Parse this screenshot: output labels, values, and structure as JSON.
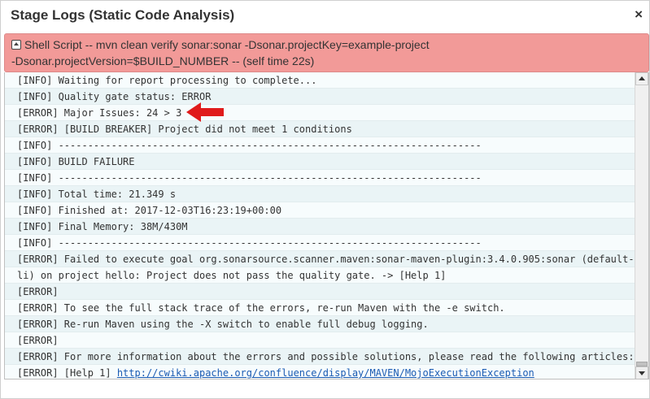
{
  "dialog": {
    "title": "Stage Logs (Static Code Analysis)",
    "close_label": "×"
  },
  "step": {
    "line1": "Shell Script -- mvn clean verify sonar:sonar -Dsonar.projectKey=example-project",
    "line2": "-Dsonar.projectVersion=$BUILD_NUMBER -- (self time 22s)"
  },
  "log": {
    "lines": [
      "[INFO] Waiting for report processing to complete...",
      "[INFO] Quality gate status: ERROR",
      "[ERROR] Major Issues: 24 > 3",
      "[ERROR] [BUILD BREAKER] Project did not meet 1 conditions",
      "[INFO] ------------------------------------------------------------------------",
      "[INFO] BUILD FAILURE",
      "[INFO] ------------------------------------------------------------------------",
      "[INFO] Total time: 21.349 s",
      "[INFO] Finished at: 2017-12-03T16:23:19+00:00",
      "[INFO] Final Memory: 38M/430M",
      "[INFO] ------------------------------------------------------------------------",
      "[ERROR] Failed to execute goal org.sonarsource.scanner.maven:sonar-maven-plugin:3.4.0.905:sonar (default-c",
      "li) on project hello: Project does not pass the quality gate. -> [Help 1]",
      "[ERROR]",
      "[ERROR] To see the full stack trace of the errors, re-run Maven with the -e switch.",
      "[ERROR] Re-run Maven using the -X switch to enable full debug logging.",
      "[ERROR]",
      "[ERROR] For more information about the errors and possible solutions, please read the following articles:"
    ],
    "help_prefix": "[ERROR] [Help 1] ",
    "help_link": "http://cwiki.apache.org/confluence/display/MAVEN/MojoExecutionException"
  },
  "colors": {
    "step_failed_bg": "#f29a98",
    "log_bg": "#f7fcfd",
    "log_alt_bg": "#eaf4f6",
    "arrow": "#e01b1b",
    "link": "#1a5bb3"
  },
  "icons": {
    "collapse": "collapse-icon",
    "close": "close-icon",
    "arrow": "red-arrow-icon"
  }
}
